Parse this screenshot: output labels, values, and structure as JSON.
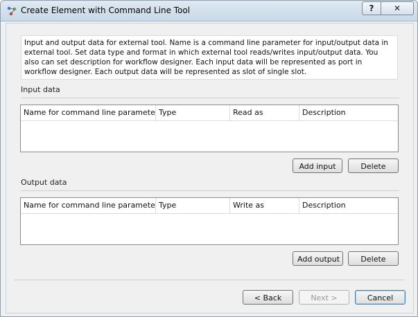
{
  "window": {
    "title": "Create Element with Command Line Tool",
    "help_label": "?",
    "close_label": "✕"
  },
  "description": "Input and output data for external tool. Name is  a command line parameter for input/output data in external tool. Set data type and format in which external tool reads/writes input/output data. You also can set description for workflow designer. Each input data will be represented as port in workflow designer. Each output data will be represented as slot of single slot.",
  "input": {
    "section_label": "Input data",
    "columns": [
      "Name for command line parameter",
      "Type",
      "Read as",
      "Description"
    ],
    "rows": [],
    "add_label": "Add input",
    "delete_label": "Delete"
  },
  "output": {
    "section_label": "Output data",
    "columns": [
      "Name for command line parameter",
      "Type",
      "Write as",
      "Description"
    ],
    "rows": [],
    "add_label": "Add output",
    "delete_label": "Delete"
  },
  "footer": {
    "back_label": "< Back",
    "next_label": "Next >",
    "cancel_label": "Cancel"
  },
  "icons": {
    "app": "workflow-element-icon",
    "help": "help-icon",
    "close": "close-icon"
  }
}
